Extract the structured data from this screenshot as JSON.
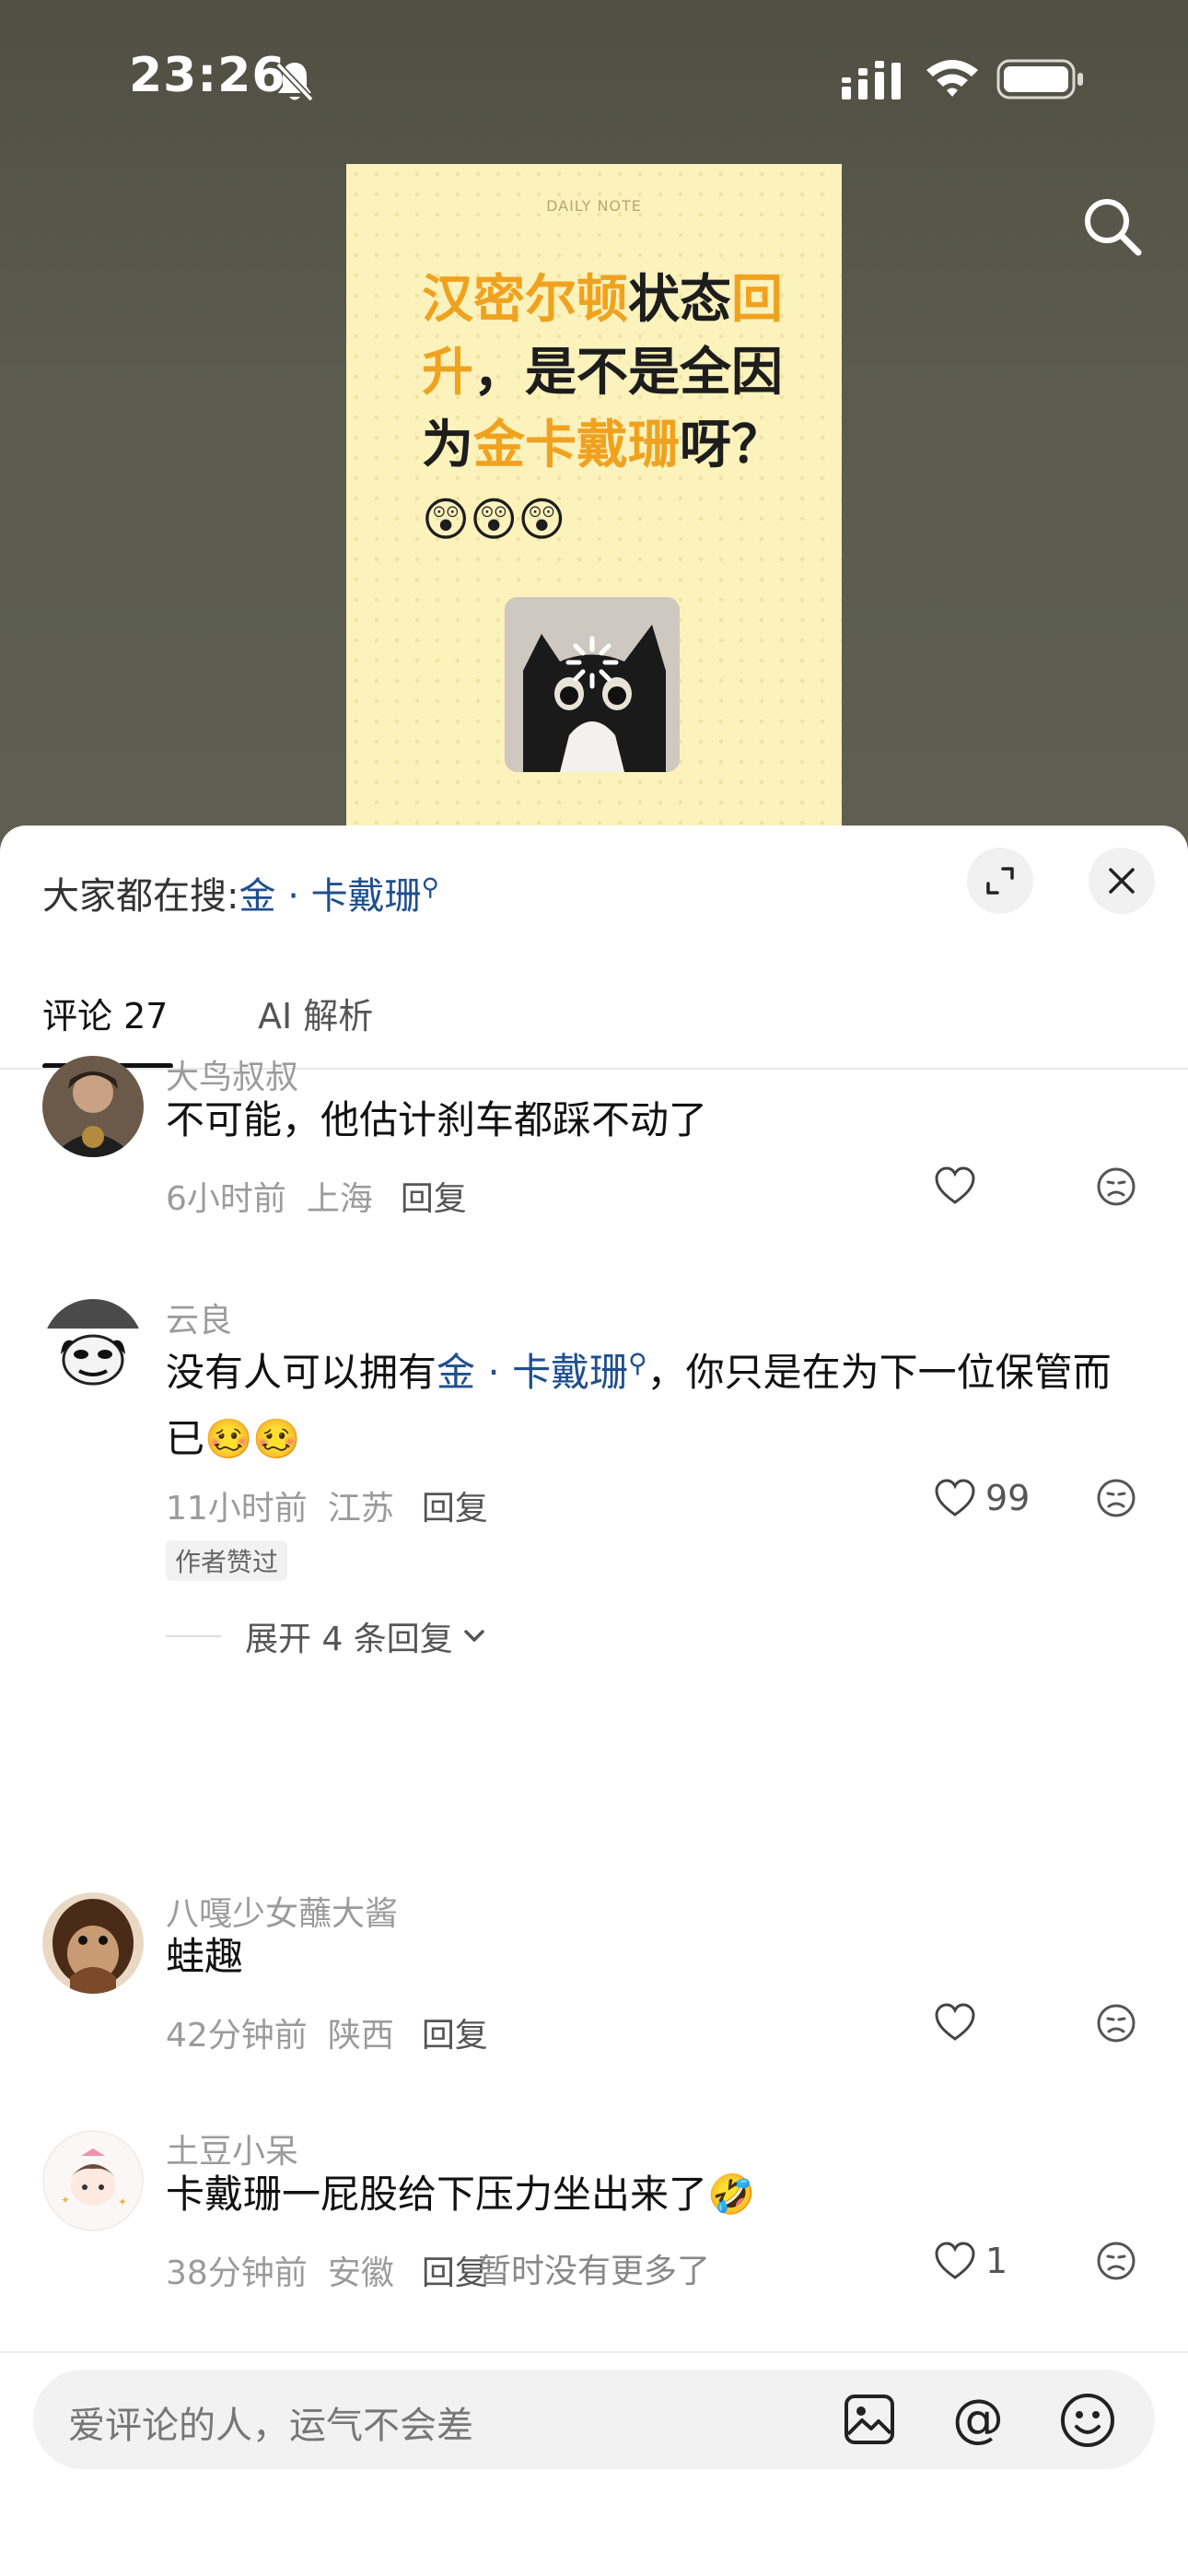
{
  "status_bar": {
    "time": "23:26",
    "icons": [
      "bell-muted-icon",
      "signal-icon",
      "wifi-icon",
      "battery-icon"
    ]
  },
  "video": {
    "note": {
      "header": "DAILY NOTE",
      "title_parts": [
        {
          "text": "汉密尔顿",
          "highlight": true
        },
        {
          "text": "状态",
          "highlight": false
        },
        {
          "text": "回升",
          "highlight": true
        },
        {
          "text": "，是不是全因为",
          "highlight": false
        },
        {
          "text": "金卡戴珊",
          "highlight": true
        },
        {
          "text": "呀？",
          "highlight": false
        }
      ],
      "emoji": "😲😲😲",
      "highlight_color": "#f0a21e"
    },
    "search_icon": "search-icon"
  },
  "sheet": {
    "hot_search_prefix": "大家都在搜:",
    "hot_search_link": "金 · 卡戴珊",
    "tabs": {
      "comments": "评论 27",
      "ai": "AI 解析"
    },
    "comments": [
      {
        "user": "大鸟叔叔",
        "text": "不可能，他估计刹车都踩不动了",
        "time": "6小时前",
        "location": "上海",
        "reply": "回复",
        "likes": ""
      },
      {
        "user": "云良",
        "text_before": "没有人可以拥有",
        "text_link": "金 · 卡戴珊",
        "text_after": "，你只是在为下一位保管而已",
        "text_emoji": "🥴🥴",
        "time": "11小时前",
        "location": "江苏",
        "reply": "回复",
        "likes": "99",
        "badge": "作者赞过",
        "expand_replies": "展开 4 条回复"
      },
      {
        "user": "八嘎少女蘸大酱",
        "text": "蛙趣",
        "time": "42分钟前",
        "location": "陕西",
        "reply": "回复",
        "likes": ""
      },
      {
        "user": "土豆小呆",
        "text": "卡戴珊一屁股给下压力坐出来了",
        "text_emoji": "🤣",
        "time": "38分钟前",
        "location": "安徽",
        "reply": "回复",
        "likes": "1"
      }
    ],
    "no_more": "暂时没有更多了",
    "input_placeholder": "爱评论的人，运气不会差",
    "input_icons": [
      "image-icon",
      "at-icon",
      "emoji-icon"
    ]
  }
}
